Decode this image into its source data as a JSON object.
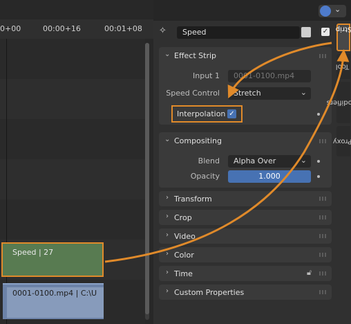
{
  "timeline": {
    "ticks": [
      "0+00",
      "00:00+16",
      "00:01+08"
    ],
    "strips": {
      "speed": "Speed | 27",
      "movie": "0001-0100.mp4 | C:\\U"
    }
  },
  "header": {
    "strip_name": "Speed"
  },
  "tabs": [
    "Strip",
    "Tool",
    "Modifiers",
    "Proxy"
  ],
  "panels": {
    "effect_strip": {
      "title": "Effect Strip",
      "input1_label": "Input 1",
      "input1_value": "0001-0100.mp4",
      "speed_control_label": "Speed Control",
      "speed_control_value": "Stretch",
      "interpolation_label": "Interpolation",
      "interpolation_checked": true
    },
    "compositing": {
      "title": "Compositing",
      "blend_label": "Blend",
      "blend_value": "Alpha Over",
      "opacity_label": "Opacity",
      "opacity_value": "1.000",
      "opacity_fraction": 1.0
    },
    "collapsed": [
      "Transform",
      "Crop",
      "Video",
      "Color",
      "Time",
      "Custom Properties"
    ]
  },
  "colors": {
    "highlight": "#e08a2a",
    "speed_strip": "#587b51",
    "movie_strip": "#879bbb",
    "accent": "#4772b3"
  }
}
